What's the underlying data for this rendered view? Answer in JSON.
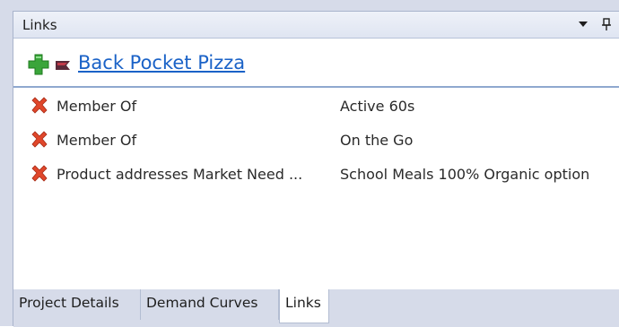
{
  "panel": {
    "title": "Links",
    "dropdown_icon": "dropdown-arrow-icon",
    "pin_icon": "pin-icon"
  },
  "record": {
    "name": "Back Pocket Pizza",
    "add_icon": "add-icon",
    "tag_icon": "tag-icon"
  },
  "links": [
    {
      "type": "Member Of",
      "target": "Active 60s",
      "icon": "delete-icon"
    },
    {
      "type": "Member Of",
      "target": "On the Go",
      "icon": "delete-icon"
    },
    {
      "type": "Product addresses Market Need ...",
      "target": "School Meals 100% Organic option",
      "icon": "delete-icon"
    }
  ],
  "tabs": [
    {
      "label": "Project Details",
      "active": false
    },
    {
      "label": "Demand Curves",
      "active": false
    },
    {
      "label": "Links",
      "active": true
    }
  ],
  "colors": {
    "link": "#1a62c7",
    "delete": "#e0472b",
    "add": "#3aa53a",
    "chrome": "#d6dbe9"
  }
}
